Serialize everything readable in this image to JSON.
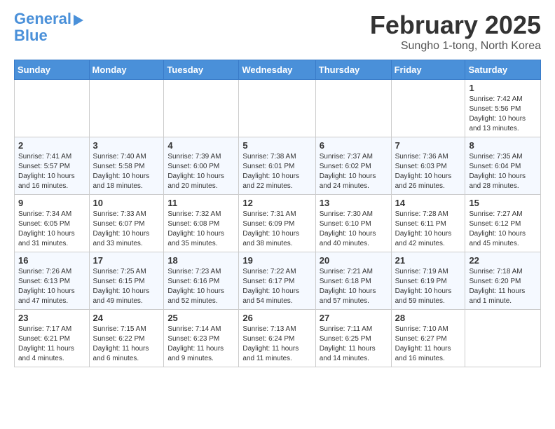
{
  "header": {
    "logo_line1": "General",
    "logo_line2": "Blue",
    "month_title": "February 2025",
    "location": "Sungho 1-tong, North Korea"
  },
  "days_of_week": [
    "Sunday",
    "Monday",
    "Tuesday",
    "Wednesday",
    "Thursday",
    "Friday",
    "Saturday"
  ],
  "weeks": [
    [
      {
        "num": "",
        "info": ""
      },
      {
        "num": "",
        "info": ""
      },
      {
        "num": "",
        "info": ""
      },
      {
        "num": "",
        "info": ""
      },
      {
        "num": "",
        "info": ""
      },
      {
        "num": "",
        "info": ""
      },
      {
        "num": "1",
        "info": "Sunrise: 7:42 AM\nSunset: 5:56 PM\nDaylight: 10 hours and 13 minutes."
      }
    ],
    [
      {
        "num": "2",
        "info": "Sunrise: 7:41 AM\nSunset: 5:57 PM\nDaylight: 10 hours and 16 minutes."
      },
      {
        "num": "3",
        "info": "Sunrise: 7:40 AM\nSunset: 5:58 PM\nDaylight: 10 hours and 18 minutes."
      },
      {
        "num": "4",
        "info": "Sunrise: 7:39 AM\nSunset: 6:00 PM\nDaylight: 10 hours and 20 minutes."
      },
      {
        "num": "5",
        "info": "Sunrise: 7:38 AM\nSunset: 6:01 PM\nDaylight: 10 hours and 22 minutes."
      },
      {
        "num": "6",
        "info": "Sunrise: 7:37 AM\nSunset: 6:02 PM\nDaylight: 10 hours and 24 minutes."
      },
      {
        "num": "7",
        "info": "Sunrise: 7:36 AM\nSunset: 6:03 PM\nDaylight: 10 hours and 26 minutes."
      },
      {
        "num": "8",
        "info": "Sunrise: 7:35 AM\nSunset: 6:04 PM\nDaylight: 10 hours and 28 minutes."
      }
    ],
    [
      {
        "num": "9",
        "info": "Sunrise: 7:34 AM\nSunset: 6:05 PM\nDaylight: 10 hours and 31 minutes."
      },
      {
        "num": "10",
        "info": "Sunrise: 7:33 AM\nSunset: 6:07 PM\nDaylight: 10 hours and 33 minutes."
      },
      {
        "num": "11",
        "info": "Sunrise: 7:32 AM\nSunset: 6:08 PM\nDaylight: 10 hours and 35 minutes."
      },
      {
        "num": "12",
        "info": "Sunrise: 7:31 AM\nSunset: 6:09 PM\nDaylight: 10 hours and 38 minutes."
      },
      {
        "num": "13",
        "info": "Sunrise: 7:30 AM\nSunset: 6:10 PM\nDaylight: 10 hours and 40 minutes."
      },
      {
        "num": "14",
        "info": "Sunrise: 7:28 AM\nSunset: 6:11 PM\nDaylight: 10 hours and 42 minutes."
      },
      {
        "num": "15",
        "info": "Sunrise: 7:27 AM\nSunset: 6:12 PM\nDaylight: 10 hours and 45 minutes."
      }
    ],
    [
      {
        "num": "16",
        "info": "Sunrise: 7:26 AM\nSunset: 6:13 PM\nDaylight: 10 hours and 47 minutes."
      },
      {
        "num": "17",
        "info": "Sunrise: 7:25 AM\nSunset: 6:15 PM\nDaylight: 10 hours and 49 minutes."
      },
      {
        "num": "18",
        "info": "Sunrise: 7:23 AM\nSunset: 6:16 PM\nDaylight: 10 hours and 52 minutes."
      },
      {
        "num": "19",
        "info": "Sunrise: 7:22 AM\nSunset: 6:17 PM\nDaylight: 10 hours and 54 minutes."
      },
      {
        "num": "20",
        "info": "Sunrise: 7:21 AM\nSunset: 6:18 PM\nDaylight: 10 hours and 57 minutes."
      },
      {
        "num": "21",
        "info": "Sunrise: 7:19 AM\nSunset: 6:19 PM\nDaylight: 10 hours and 59 minutes."
      },
      {
        "num": "22",
        "info": "Sunrise: 7:18 AM\nSunset: 6:20 PM\nDaylight: 11 hours and 1 minute."
      }
    ],
    [
      {
        "num": "23",
        "info": "Sunrise: 7:17 AM\nSunset: 6:21 PM\nDaylight: 11 hours and 4 minutes."
      },
      {
        "num": "24",
        "info": "Sunrise: 7:15 AM\nSunset: 6:22 PM\nDaylight: 11 hours and 6 minutes."
      },
      {
        "num": "25",
        "info": "Sunrise: 7:14 AM\nSunset: 6:23 PM\nDaylight: 11 hours and 9 minutes."
      },
      {
        "num": "26",
        "info": "Sunrise: 7:13 AM\nSunset: 6:24 PM\nDaylight: 11 hours and 11 minutes."
      },
      {
        "num": "27",
        "info": "Sunrise: 7:11 AM\nSunset: 6:25 PM\nDaylight: 11 hours and 14 minutes."
      },
      {
        "num": "28",
        "info": "Sunrise: 7:10 AM\nSunset: 6:27 PM\nDaylight: 11 hours and 16 minutes."
      },
      {
        "num": "",
        "info": ""
      }
    ]
  ]
}
